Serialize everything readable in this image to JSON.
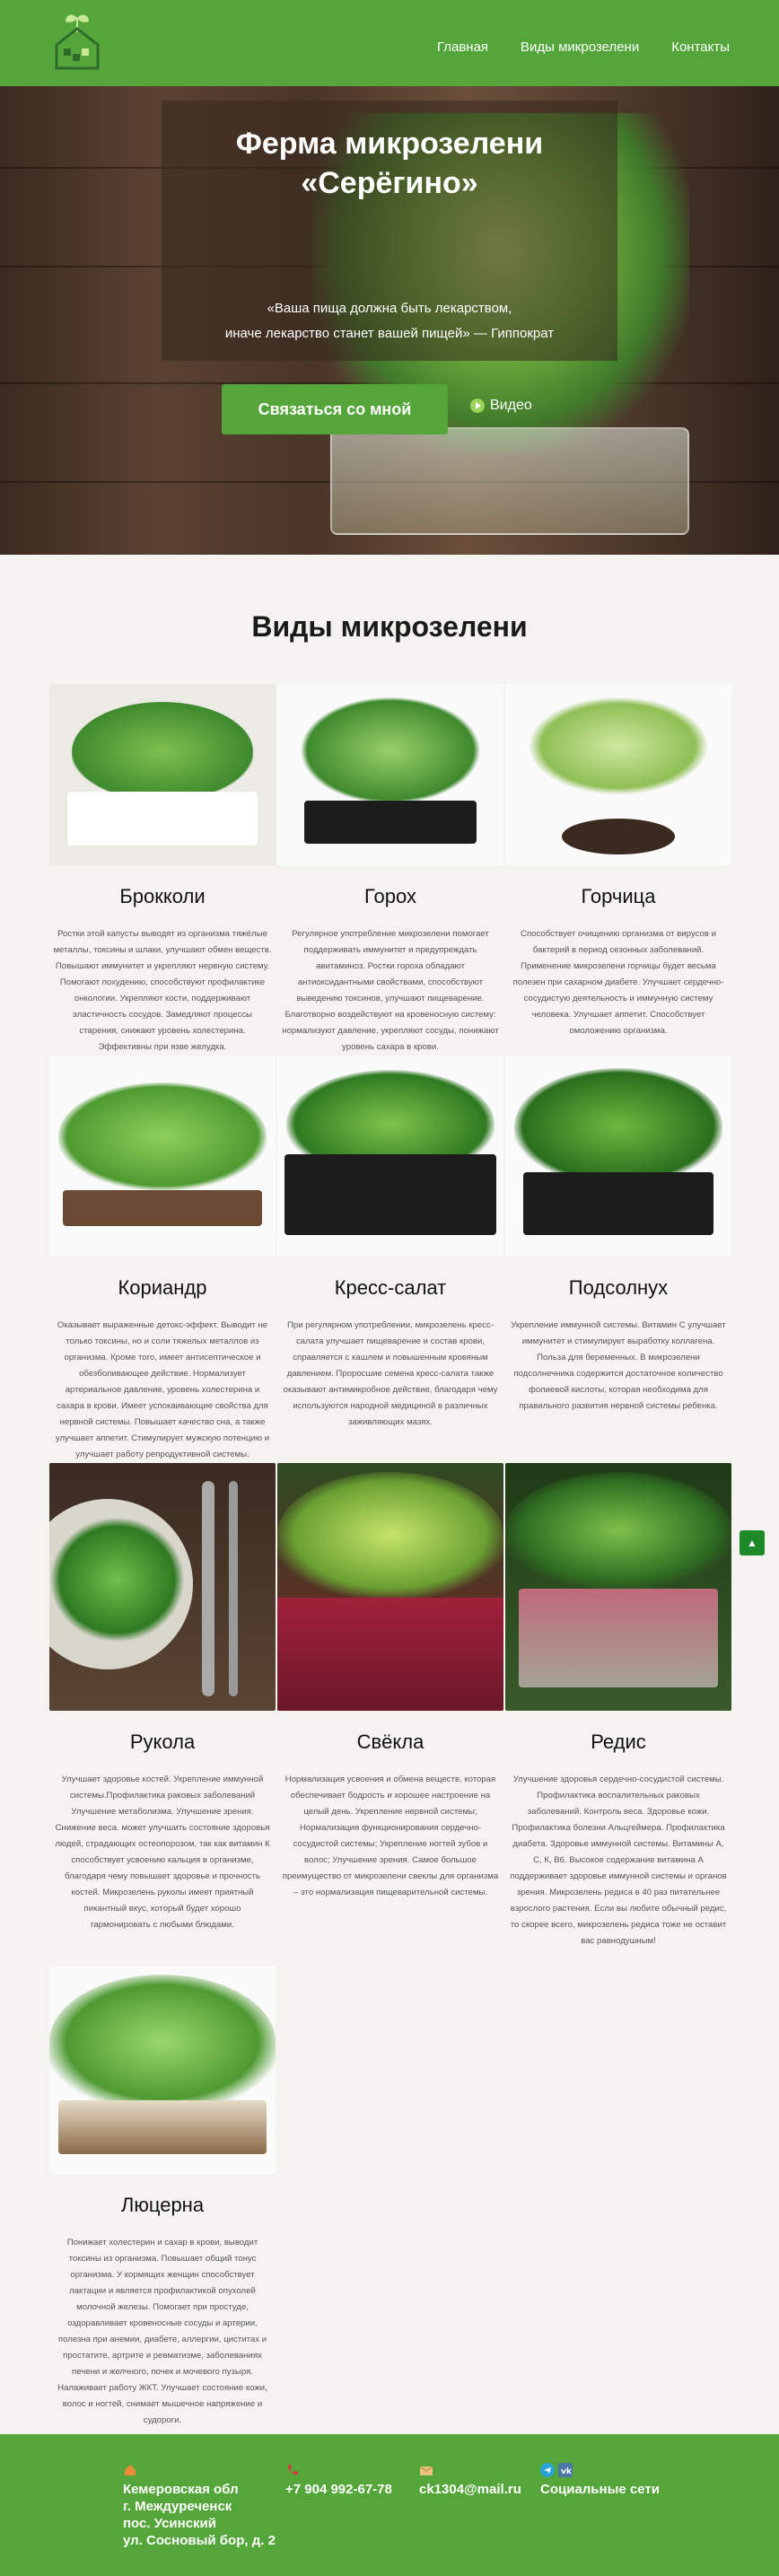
{
  "nav": {
    "home": "Главная",
    "types": "Виды микрозелени",
    "contacts": "Контакты"
  },
  "hero": {
    "title_line1": "Ферма микрозелени",
    "title_line2": "«Серёгино»",
    "quote_line1": "«Ваша пища должна быть лекарством,",
    "quote_line2": "иначе лекарство станет вашей пищей» — Гиппократ",
    "contact_button": "Связаться со мной",
    "video_label": "Видео"
  },
  "section_title": "Виды микрозелени",
  "cards": [
    {
      "name": "Брокколи",
      "desc": "Ростки этой капусты выводят из организма тяжёлые металлы, токсины и шлаки, улучшают обмен веществ. Повышают иммунитет и укрепляют нервную систему. Помогают похудению, способствуют профилактике онкологии. Укрепляют кости, поддерживают эластичность сосудов. Замедляют процессы старения, снижают уровень холестерина. Эффективны при язве желудка."
    },
    {
      "name": "Горох",
      "desc": "Регулярное употребление микрозелени помогает поддерживать иммунитет и предупреждать авитаминоз. Ростки гороха обладают антиоксидантными свойствами, способствуют выведению токсинов, улучшают пищеварение. Благотворно воздействуют на кровеносную систему: нормализуют давление, укрепляют сосуды, понижают уровень сахара в крови."
    },
    {
      "name": "Горчица",
      "desc": "Способствует очищению организма от вирусов и бактерий в период сезонных заболеваний. Применение микрозелени горчицы будет весьма полезен при сахарном диабете. Улучшает сердечно-сосудистую деятельность и иммунную систему человека. Улучшает аппетит. Способствует омоложению организма."
    },
    {
      "name": "Кориандр",
      "desc": "Оказывает выраженные детокс-эффект. Выводит не только токсины, но и соли тяжелых металлов из организма. Кроме того, имеет антисептическое и обезболивающее действие. Нормализует артериальное давление, уровень холестерина и сахара в крови. Имеет успокаивающие свойства для нервной системы. Повышает качество сна, а также улучшает аппетит. Стимулирует мужскую потенцию и улучшает работу репродуктивной системы."
    },
    {
      "name": "Кресс-салат",
      "desc": "При регулярном употреблении, микрозелень кресс-салата улучшает пищеварение и состав крови, справляется с кашлем и повышенным кровяным давлением. Проросшие семена кресс-салата также оказывают антимикробное действие, благодаря чему используются народной медициной в различных заживляющих мазях."
    },
    {
      "name": "Подсолнух",
      "desc": "Укрепление иммунной системы. Витамин С улучшает иммунитет и стимулирует выработку коллагена. Польза для беременных. В микрозелени подсолнечника содержится достаточное количество фолиевой кислоты, которая необходима для правильного развития нервной системы ребенка."
    },
    {
      "name": "Рукола",
      "desc": "Улучшает здоровье костей. Укрепление иммунной системы.Профилактика раковых заболеваний Улучшение метаболизма. Улучшение зрения. Снижение веса. может улучшить состояние здоровья людей, страдающих остеопорозом, так как витамин К способствует усвоению кальция в организме, благодаря чему повышает здоровье и прочность костей. Микрозелень руколы имеет приятный пикантный вкус, который будет хорошо гармонировать с любыми блюдами."
    },
    {
      "name": "Свёкла",
      "desc": "Нормализация усвоения и обмена веществ, которая обеспечивает бодрость и хорошее настроение на целый день. Укрепление нервной системы; Нормализация функционирования сердечно-сосудистой системы; Укрепление ногтей зубов и волос; Улучшение зрения. Самое большое преимущество от микрозелени свеклы для организма – это нормализация пищеварительной системы."
    },
    {
      "name": "Редис",
      "desc": "Улучшение здоровья сердечно-сосудистой системы. Профилактика воспалительных раковых заболеваний. Контроль веса. Здоровье кожи. Профилактика болезни Альцгеймера. Профилактика диабета. Здоровье иммунной системы. Витамины А, С, К, В6. Высокое содержание витамина А поддерживает здоровье иммунной системы и органов зрения. Микрозелень редиса в 40 раз питательнее взрослого растения. Если вы любите обычный редис, то скорее всего, микрозелень редиса тоже не оставит вас равнодушным!"
    },
    {
      "name": "Люцерна",
      "desc": "Понижает холестерин и сахар в крови, выводит токсины из организма. Повышает общий тонус организма. У кормящих женщин способствует лактации и является профилактикой опухолей молочной железы. Помогает при простуде, оздоравливает кровеносные сосуды и артерии, полезна при анемии, диабете, аллергии, циститах и простатите, артрите и ревматизме, заболеваниях печени и желчного, почек и мочевого пузыря. Налаживает работу ЖКТ. Улучшает состояние кожи, волос и ногтей, снимает мышечное напряжение и судороги."
    }
  ],
  "scroll_up": "▲",
  "footer": {
    "address_line1": "Кемеровская обл",
    "address_line2": "г. Междуреченск",
    "address_line3": "пос. Усинский",
    "address_line4": "ул. Сосновый бор, д. 2",
    "phone": "+7 904 992-67-78",
    "email": "ck1304@mail.ru",
    "social": "Социальные сети"
  },
  "colors": {
    "brand_green": "#55a63a",
    "background": "#f5f3ef"
  }
}
